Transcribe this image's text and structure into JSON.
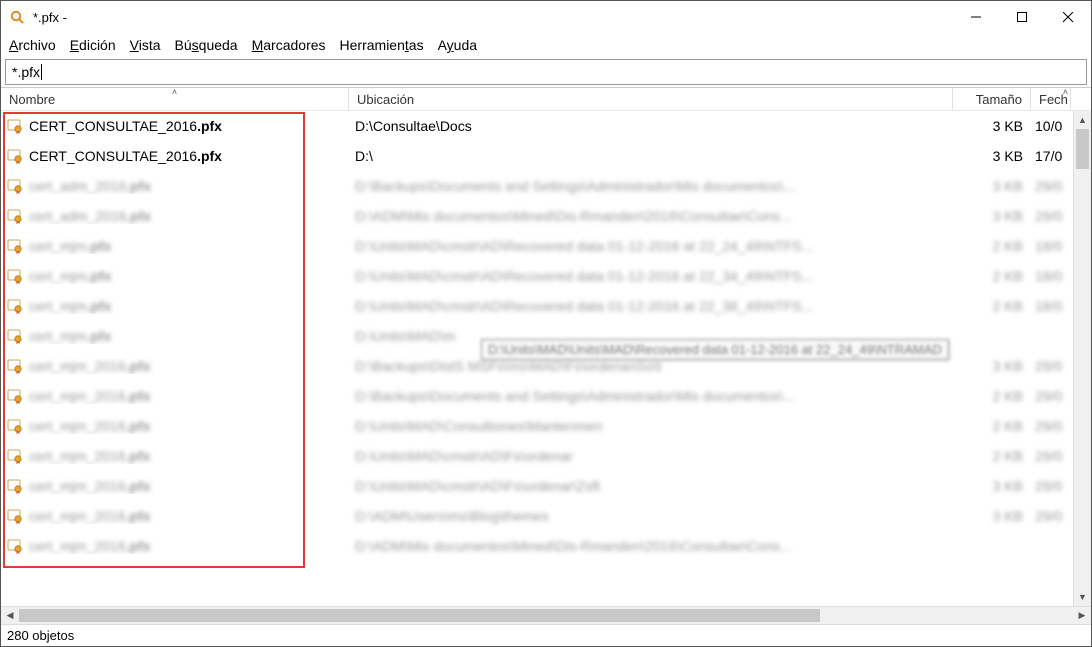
{
  "window": {
    "title": "*.pfx -"
  },
  "menu": {
    "archivo": "Archivo",
    "edicion": "Edición",
    "vista": "Vista",
    "busqueda": "Búsqueda",
    "marcadores": "Marcadores",
    "herramientas": "Herramientas",
    "ayuda": "Ayuda"
  },
  "search": {
    "value": "*.pfx"
  },
  "columns": {
    "name": "Nombre",
    "location": "Ubicación",
    "size": "Tamaño",
    "date": "Fech"
  },
  "rows": [
    {
      "name": "CERT_CONSULTAE_2016",
      "ext": ".pfx",
      "location": "D:\\Consultae\\Docs",
      "size": "3 KB",
      "date": "10/0",
      "clear": true
    },
    {
      "name": "CERT_CONSULTAE_2016",
      "ext": ".pfx",
      "location": "D:\\",
      "size": "3 KB",
      "date": "17/0",
      "clear": true
    },
    {
      "name": "cert_adm_2016",
      "ext": ".pfx",
      "location": "D:\\Backups\\Documents and Settings\\Administrador\\Mis documentos\\...",
      "size": "3 KB",
      "date": "29/0",
      "clear": false
    },
    {
      "name": "cert_adm_2016",
      "ext": ".pfx",
      "location": "D:\\ADM\\Mis documentos\\Mined\\Dis-Rmanden\\2016\\Consultae\\Cons...",
      "size": "3 KB",
      "date": "29/0",
      "clear": false
    },
    {
      "name": "cert_mjm",
      "ext": ".pfx",
      "location": "D:\\Units\\MAD\\cmstr\\AD\\Recovered data 01-12-2016 at 22_24_49\\NTFS...",
      "size": "2 KB",
      "date": "18/0",
      "clear": false
    },
    {
      "name": "cert_mjm",
      "ext": ".pfx",
      "location": "D:\\Units\\MAD\\cmstr\\AD\\Recovered data 01-12-2016 at 22_34_49\\NTFS...",
      "size": "2 KB",
      "date": "18/0",
      "clear": false
    },
    {
      "name": "cert_mjm",
      "ext": ".pfx",
      "location": "D:\\Units\\MAD\\cmstr\\AD\\Recovered data 01-12-2016 at 22_38_49\\NTFS...",
      "size": "2 KB",
      "date": "18/0",
      "clear": false
    },
    {
      "name": "cert_mjm",
      "ext": ".pfx",
      "location": "D:\\Units\\MAD\\m",
      "size": "",
      "date": "",
      "clear": false
    },
    {
      "name": "cert_mjm_2016",
      "ext": ".pfx",
      "location": "D:\\Backups\\DistS MSFs\\ms\\MAD\\Fs\\ordenanSo\\t",
      "size": "3 KB",
      "date": "29/0",
      "clear": false
    },
    {
      "name": "cert_mjm_2016",
      "ext": ".pfx",
      "location": "D:\\Backups\\Documents and Settings\\Administrador\\Mis documentos\\...",
      "size": "2 KB",
      "date": "29/0",
      "clear": false
    },
    {
      "name": "cert_mjm_2016",
      "ext": ".pfx",
      "location": "D:\\Units\\MAD\\Consultiones\\Mantenmen",
      "size": "2 KB",
      "date": "29/0",
      "clear": false
    },
    {
      "name": "cert_mjm_2016",
      "ext": ".pfx",
      "location": "D:\\Units\\MAD\\cmstr\\AD\\Fs\\ordenar",
      "size": "2 KB",
      "date": "29/0",
      "clear": false
    },
    {
      "name": "cert_mjm_2016",
      "ext": ".pfx",
      "location": "D:\\Units\\MAD\\cmstr\\AD\\Fs\\ordenar\\Zsft",
      "size": "3 KB",
      "date": "29/0",
      "clear": false
    },
    {
      "name": "cert_mjm_2016",
      "ext": ".pfx",
      "location": "D:\\ADM\\Users\\ms\\Blog\\themes",
      "size": "3 KB",
      "date": "29/0",
      "clear": false
    },
    {
      "name": "cert_mjm_2016",
      "ext": ".pfx",
      "location": "D:\\ADM\\Mis documentos\\Mined\\Dis-Rmanden\\2016\\Consultae\\Cons...",
      "size": "",
      "date": "",
      "clear": false
    }
  ],
  "tooltip": "D:\\Units\\MAD\\Units\\MAD\\Recovered data 01-12-2016 at 22_24_49\\NTRAMAD",
  "status": "280 objetos"
}
